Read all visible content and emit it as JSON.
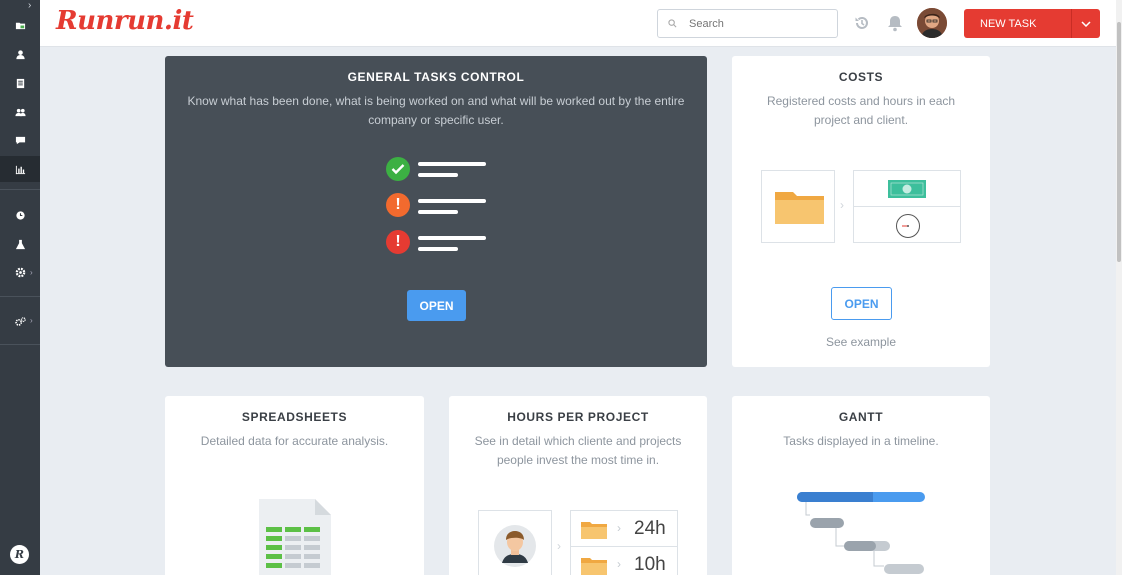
{
  "header": {
    "logo": "Runrun.it",
    "search_placeholder": "Search",
    "new_task_label": "NEW TASK"
  },
  "sidebar": {
    "items": [
      {
        "icon": "folder-icon"
      },
      {
        "icon": "user-icon"
      },
      {
        "icon": "document-icon"
      },
      {
        "icon": "team-icon"
      },
      {
        "icon": "chat-icon"
      },
      {
        "icon": "bar-chart-icon",
        "active": true
      },
      {
        "icon": "clock-icon"
      },
      {
        "icon": "flask-icon"
      },
      {
        "icon": "gear-icon"
      },
      {
        "icon": "gears-icon"
      }
    ],
    "bottom_badge": "R"
  },
  "cards": {
    "general": {
      "title": "GENERAL TASKS CONTROL",
      "description": "Know what has been done, what is being worked on and what will be worked out by the entire company or specific user.",
      "button": "OPEN",
      "status_rows": [
        "done",
        "warning",
        "alert"
      ]
    },
    "costs": {
      "title": "COSTS",
      "description": "Registered costs and hours in each project and client.",
      "button": "OPEN",
      "link": "See example"
    },
    "spreadsheets": {
      "title": "SPREADSHEETS",
      "description": "Detailed data for accurate analysis."
    },
    "hours": {
      "title": "HOURS PER PROJECT",
      "description": "See in detail which cliente and projects people invest the most time in.",
      "values": [
        "24h",
        "10h"
      ]
    },
    "gantt": {
      "title": "GANTT",
      "description": "Tasks displayed in a timeline."
    }
  },
  "colors": {
    "brand": "#e53b32",
    "accent": "#4a9bef",
    "sidebar": "#353c44",
    "dark_card": "#474f57",
    "success": "#3cb043",
    "warning": "#f26a2e",
    "danger": "#e53b32"
  }
}
